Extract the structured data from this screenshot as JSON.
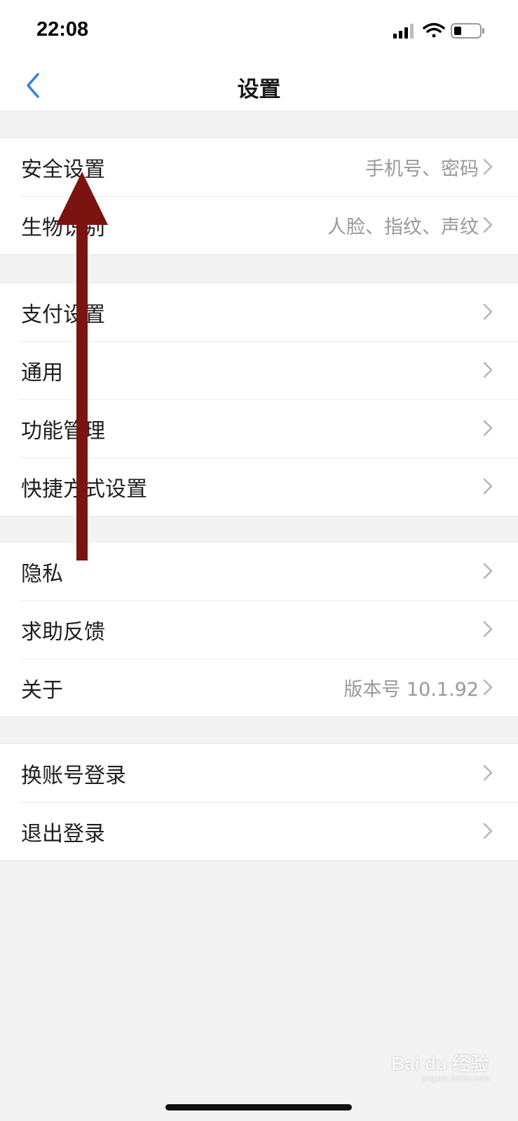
{
  "status_bar": {
    "time": "22:08"
  },
  "header": {
    "title": "设置",
    "back_icon": "chevron-left-icon"
  },
  "accent_color": "#2f80ed",
  "annotation_color": "#7b1410",
  "groups": [
    [
      {
        "label": "安全设置",
        "value": "手机号、密码"
      },
      {
        "label": "生物识别",
        "value": "人脸、指纹、声纹"
      }
    ],
    [
      {
        "label": "支付设置",
        "value": ""
      },
      {
        "label": "通用",
        "value": ""
      },
      {
        "label": "功能管理",
        "value": ""
      },
      {
        "label": "快捷方式设置",
        "value": ""
      }
    ],
    [
      {
        "label": "隐私",
        "value": ""
      },
      {
        "label": "求助反馈",
        "value": ""
      },
      {
        "label": "关于",
        "value": "版本号 10.1.92"
      }
    ],
    [
      {
        "label": "换账号登录",
        "value": ""
      },
      {
        "label": "退出登录",
        "value": ""
      }
    ]
  ],
  "watermark": {
    "text": "Bai du 经验",
    "sub": "jingyan.baidu.com"
  }
}
